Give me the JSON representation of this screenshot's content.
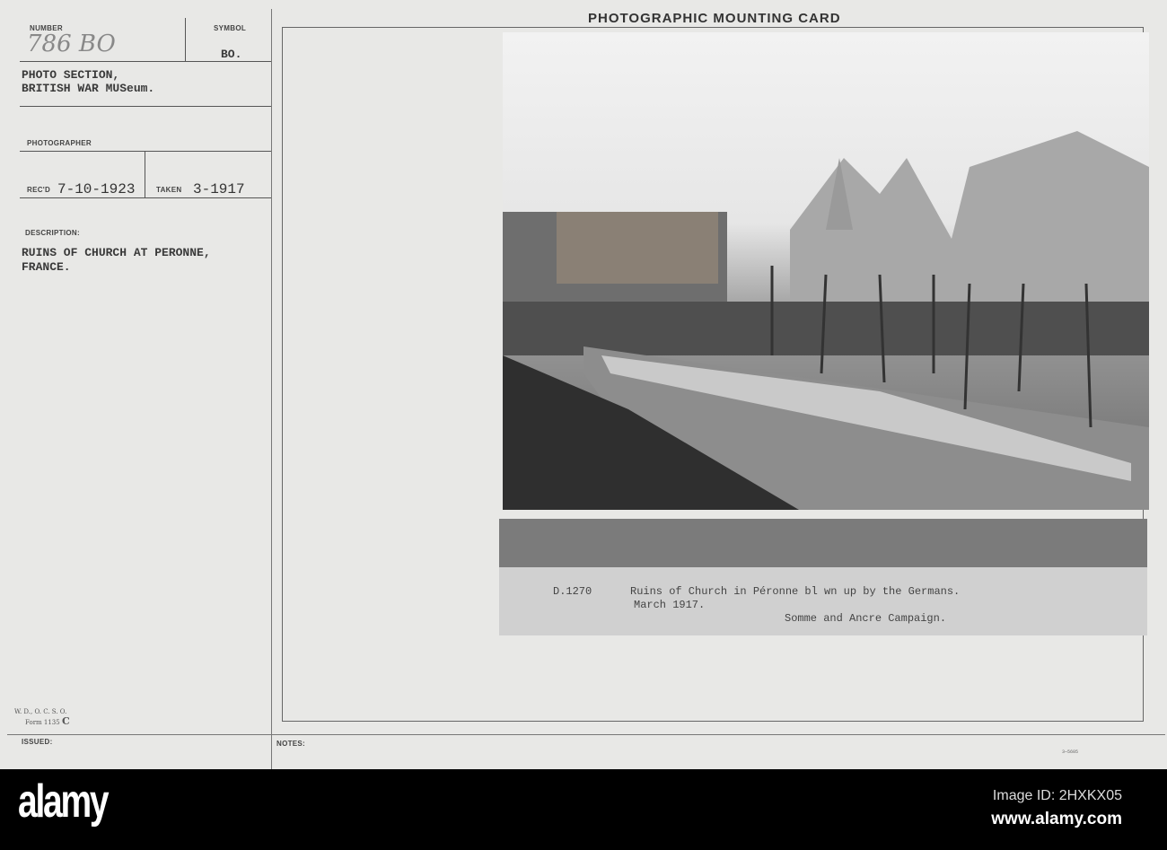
{
  "card": {
    "title": "PHOTOGRAPHIC MOUNTING CARD",
    "number_label": "NUMBER",
    "number_value": "786 BO",
    "symbol_label": "SYMBOL",
    "symbol_value": "BO.",
    "source_line1": "PHOTO SECTION,",
    "source_line2": "BRITISH WAR MUSeum.",
    "photographer_label": "PHOTOGRAPHER",
    "recd_label": "REC'D",
    "recd_value": "7-10-1923",
    "taken_label": "TAKEN",
    "taken_value": "3-1917",
    "description_label": "DESCRIPTION:",
    "description_line1": "RUINS OF CHURCH AT PERONNE,",
    "description_line2": "FRANCE.",
    "form_line1": "W. D., O. C. S. O.",
    "form_line2": "Form 1135",
    "form_suffix": "C",
    "issued_label": "ISSUED:",
    "notes_label": "NOTES:",
    "print_code": "3—5605"
  },
  "photo": {
    "caption_code": "D.1270",
    "caption_line1": "Ruins of Church in Péronne bl wn up by the Germans.",
    "caption_line2": "March 1917.",
    "caption_line3": "Somme and Ancre Campaign."
  },
  "footer": {
    "logo": "alamy",
    "image_id": "Image ID: 2HXKX05",
    "url": "www.alamy.com"
  }
}
